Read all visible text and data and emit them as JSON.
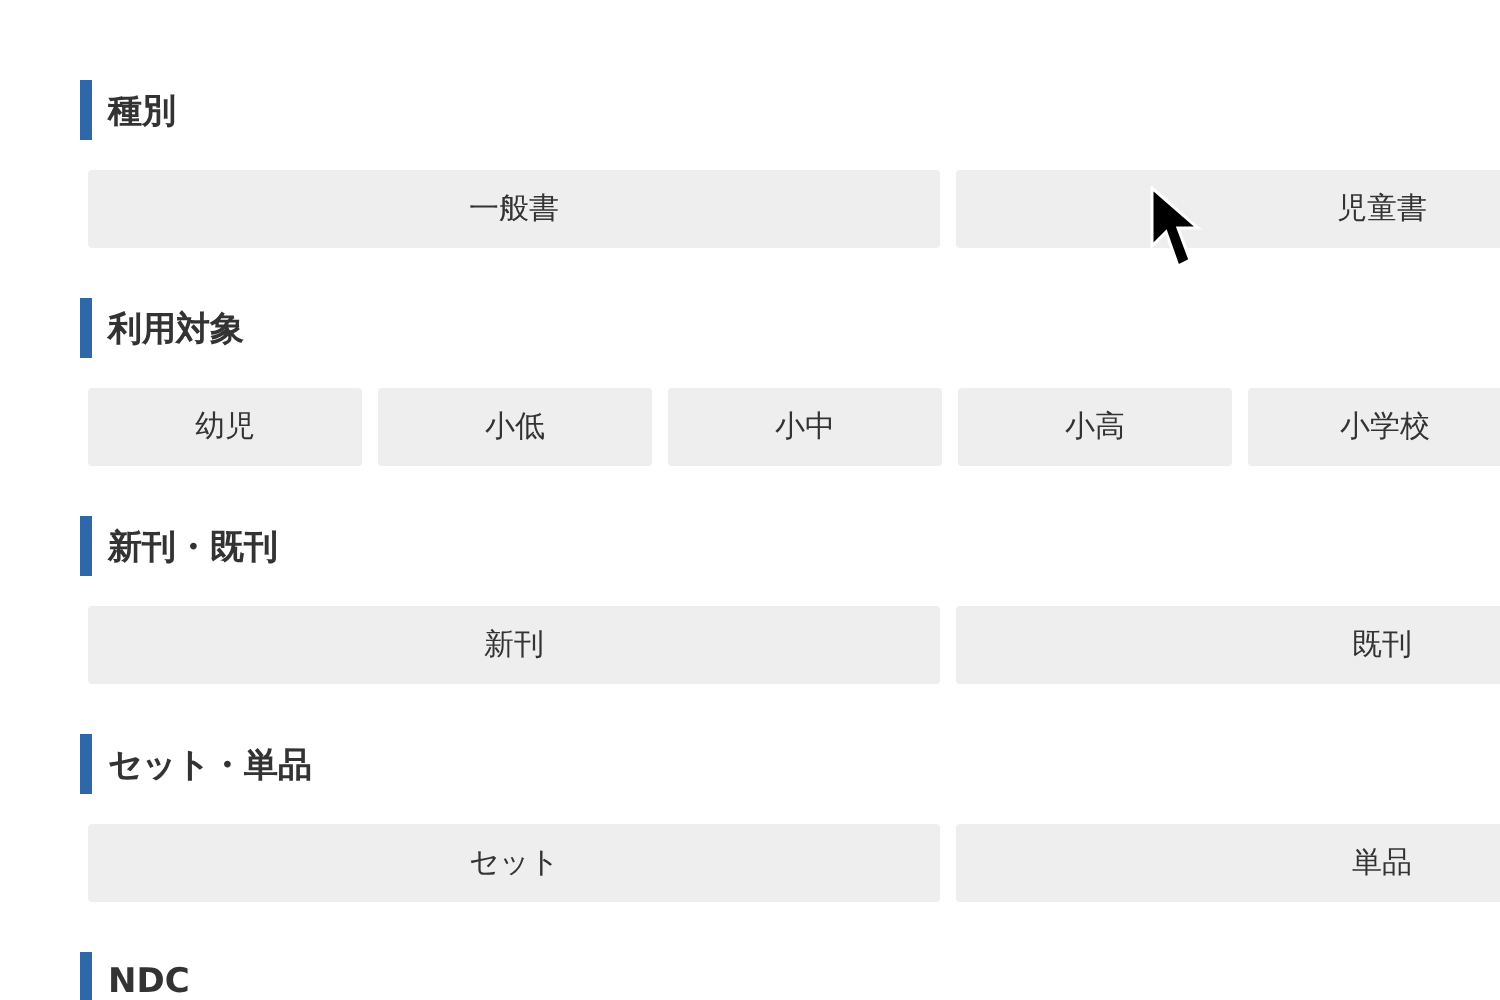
{
  "sections": [
    {
      "title": "種別",
      "options": [
        "一般書",
        "児童書"
      ]
    },
    {
      "title": "利用対象",
      "options": [
        "幼児",
        "小低",
        "小中",
        "小高",
        "小学校"
      ]
    },
    {
      "title": "新刊・既刊",
      "options": [
        "新刊",
        "既刊"
      ]
    },
    {
      "title": "セット・単品",
      "options": [
        "セット",
        "単品"
      ]
    },
    {
      "title": "NDC"
    }
  ]
}
